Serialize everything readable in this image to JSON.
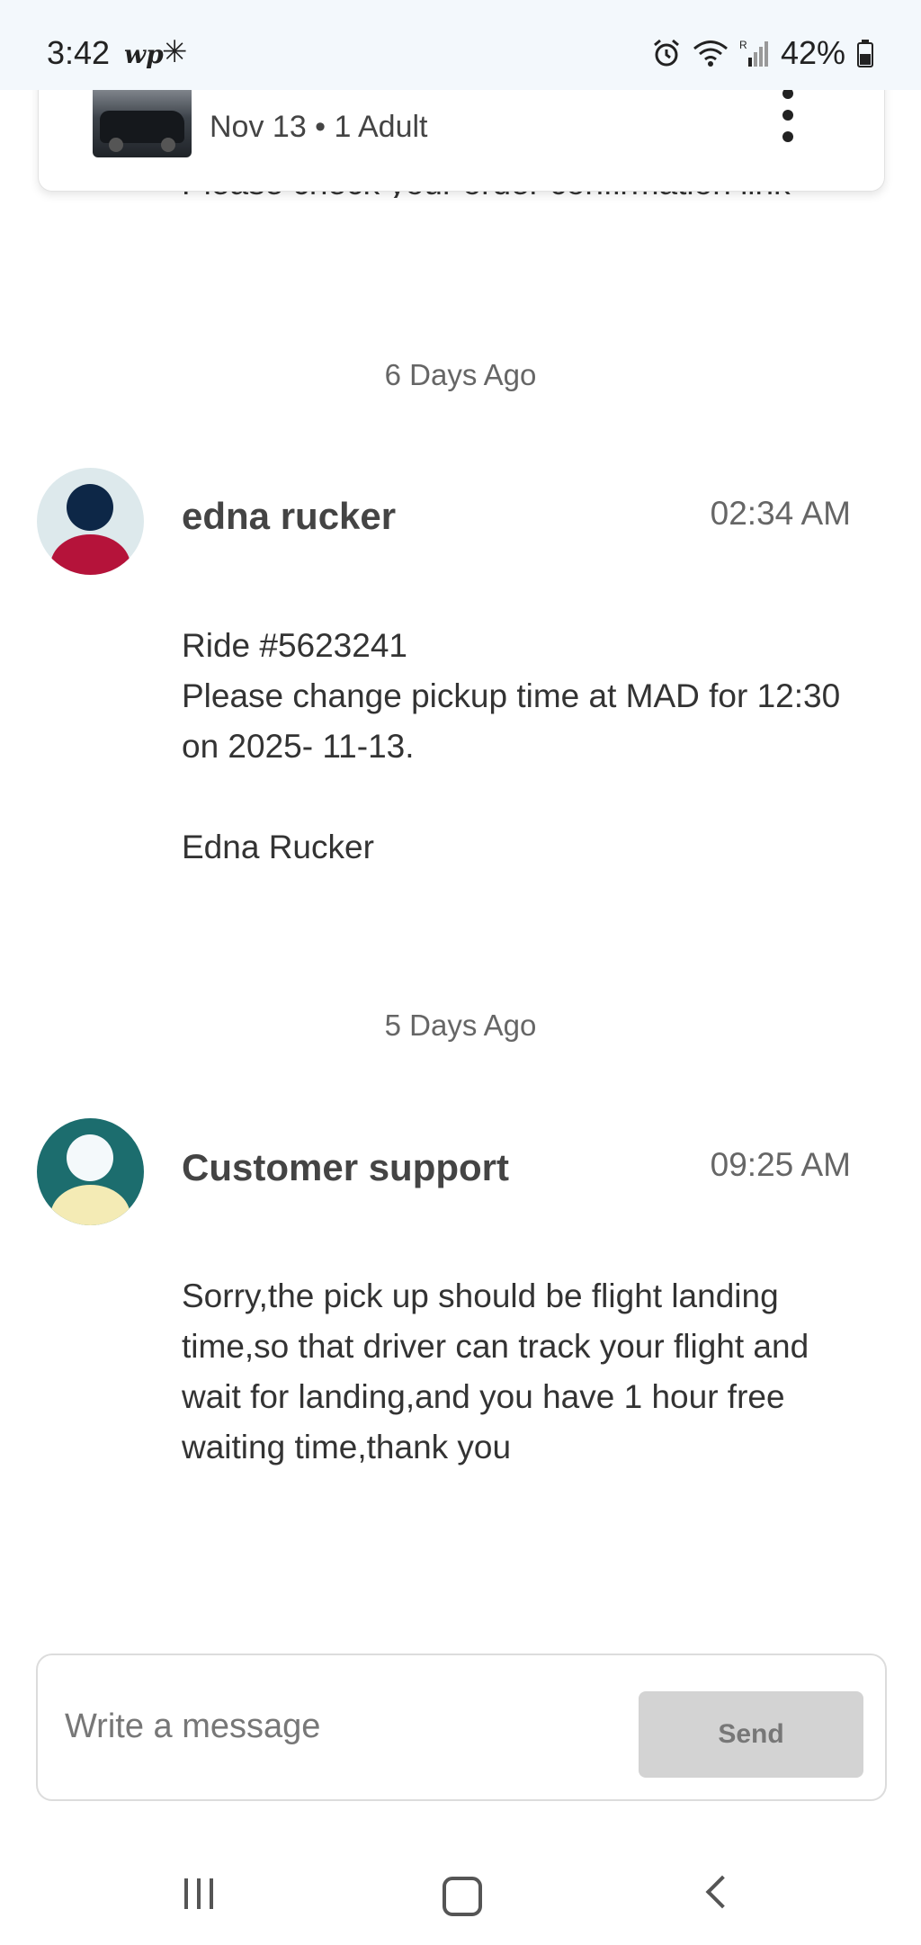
{
  "status_bar": {
    "time": "3:42",
    "app_icon_text": "wp",
    "battery_percent": "42%"
  },
  "ride_card": {
    "meta": "Nov 13 • 1 Adult"
  },
  "previous_message_tail": "Please check your order confirmation link",
  "thread": [
    {
      "separator": "6 Days Ago",
      "sender": "edna rucker",
      "time": "02:34 AM",
      "avatar_colors": {
        "bg": "#dde9ec",
        "head": "#0d2747",
        "body": "#b5133a"
      },
      "body": "Ride #5623241\nPlease change pickup time at MAD for 12:30 on 2025- 11-13.\n\nEdna Rucker"
    },
    {
      "separator": "5 Days Ago",
      "sender": "Customer support",
      "time": "09:25 AM",
      "avatar_colors": {
        "bg": "#1c6d6e",
        "head": "#f4f9fb",
        "body": "#f4ebb5"
      },
      "body": "Sorry,the pick up should be flight landing time,so that driver can track your flight and wait for landing,and you have 1 hour free waiting time,thank you"
    }
  ],
  "composer": {
    "placeholder": "Write a message",
    "send_label": "Send"
  }
}
